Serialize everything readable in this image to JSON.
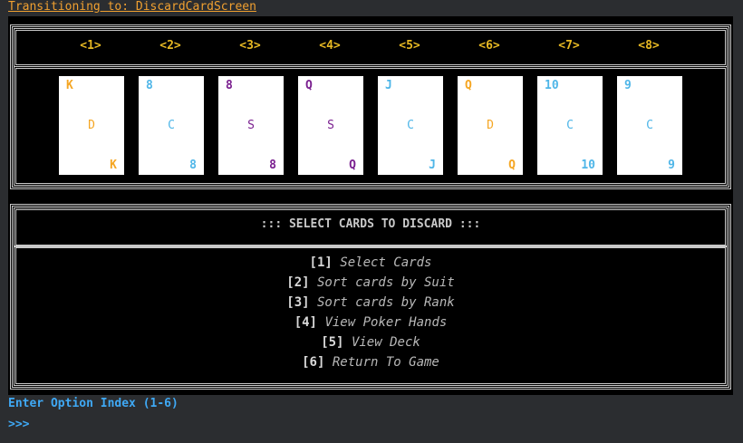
{
  "transition": "Transitioning to: DiscardCardScreen",
  "slots": [
    "<1>",
    "<2>",
    "<3>",
    "<4>",
    "<5>",
    "<6>",
    "<7>",
    "<8>"
  ],
  "cards": [
    {
      "rank": "K",
      "suit": "D"
    },
    {
      "rank": "8",
      "suit": "C"
    },
    {
      "rank": "8",
      "suit": "S"
    },
    {
      "rank": "Q",
      "suit": "S"
    },
    {
      "rank": "J",
      "suit": "C"
    },
    {
      "rank": "Q",
      "suit": "D"
    },
    {
      "rank": "10",
      "suit": "C"
    },
    {
      "rank": "9",
      "suit": "C"
    }
  ],
  "suit_colors": {
    "D": "#f5a623",
    "C": "#4fb6e8",
    "S": "#7a1f8f"
  },
  "menu_title": "::: SELECT CARDS TO DISCARD :::",
  "menu": [
    {
      "index": "[1]",
      "label": "Select Cards"
    },
    {
      "index": "[2]",
      "label": "Sort cards by Suit"
    },
    {
      "index": "[3]",
      "label": "Sort cards by Rank"
    },
    {
      "index": "[4]",
      "label": "View Poker Hands"
    },
    {
      "index": "[5]",
      "label": "View Deck"
    },
    {
      "index": "[6]",
      "label": "Return To Game"
    }
  ],
  "prompt": "Enter Option Index (1-6)",
  "cursor": ">>>"
}
